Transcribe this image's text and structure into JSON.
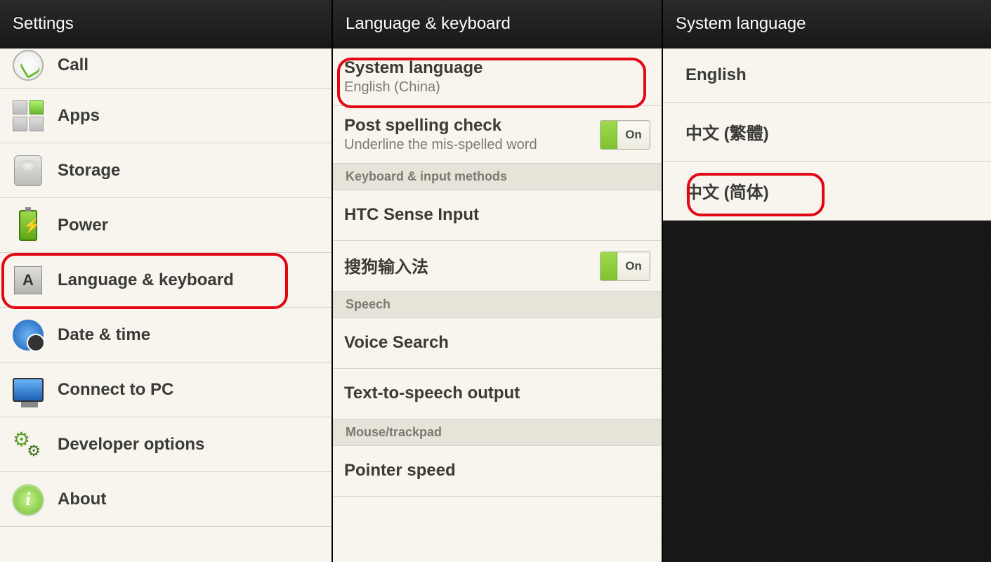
{
  "panel1": {
    "title": "Settings",
    "items": [
      {
        "label": "Call"
      },
      {
        "label": "Apps"
      },
      {
        "label": "Storage"
      },
      {
        "label": "Power"
      },
      {
        "label": "Language & keyboard"
      },
      {
        "label": "Date & time"
      },
      {
        "label": "Connect to PC"
      },
      {
        "label": "Developer options"
      },
      {
        "label": "About"
      }
    ]
  },
  "panel2": {
    "title": "Language & keyboard",
    "systemLanguage": {
      "title": "System language",
      "value": "English (China)"
    },
    "spellCheck": {
      "title": "Post spelling check",
      "sub": "Underline the mis-spelled word",
      "toggle": "On"
    },
    "section1": "Keyboard & input methods",
    "htcSense": "HTC Sense Input",
    "sogou": {
      "label": "搜狗输入法",
      "toggle": "On"
    },
    "section2": "Speech",
    "voiceSearch": "Voice Search",
    "tts": "Text-to-speech output",
    "section3": "Mouse/trackpad",
    "pointerSpeed": "Pointer speed"
  },
  "panel3": {
    "title": "System language",
    "options": [
      "English",
      "中文 (繁體)",
      "中文 (简体)"
    ]
  }
}
